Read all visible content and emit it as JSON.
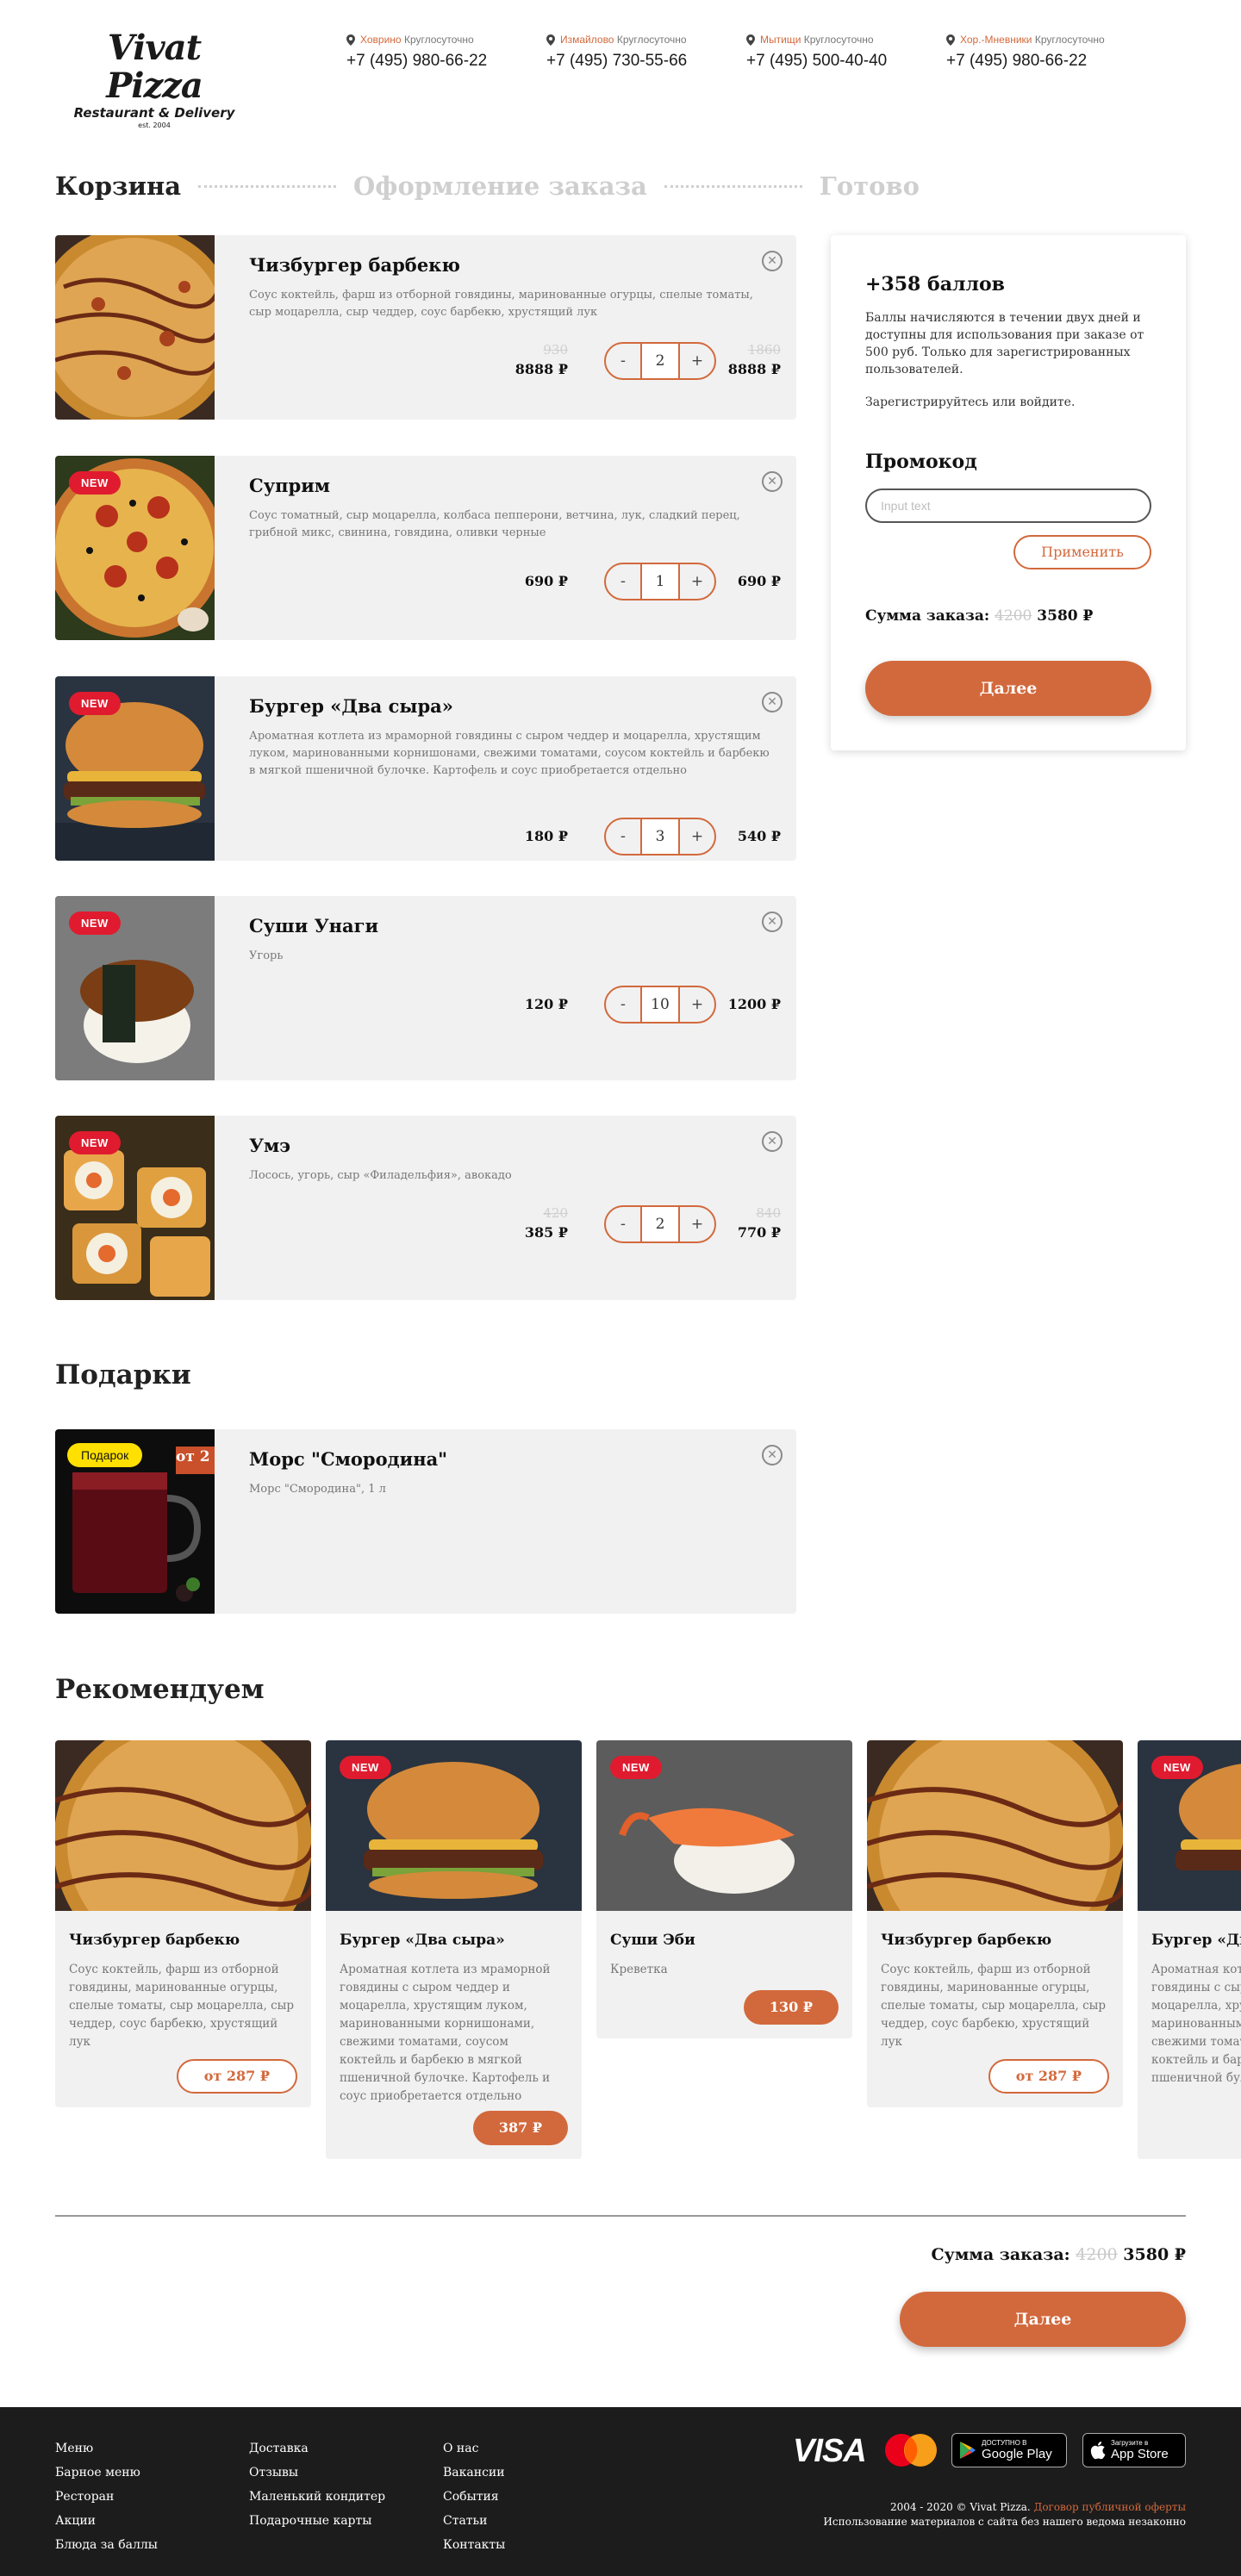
{
  "header": {
    "logo": {
      "line1": "Vivat Pizza",
      "line2": "Restaurant & Delivery",
      "line3": "est. 2004"
    },
    "contacts": [
      {
        "area": "Ховрино",
        "hours": "Круглосуточно",
        "phone": "+7 (495) 980-66-22"
      },
      {
        "area": "Измайлово",
        "hours": "Круглосуточно",
        "phone": "+7 (495) 730-55-66"
      },
      {
        "area": "Мытищи",
        "hours": "Круглосуточно",
        "phone": "+7 (495) 500-40-40"
      },
      {
        "area": "Хор.-Мневники",
        "hours": "Круглосуточно",
        "phone": "+7 (495) 980-66-22"
      }
    ]
  },
  "steps": {
    "cart": "Корзина",
    "checkout": "Оформление заказа",
    "done": "Готово"
  },
  "cart": {
    "items": [
      {
        "title": "Чизбургер барбекю",
        "desc": "Соус коктейль, фарш из отборной говядины, маринованные огурцы, спелые томаты, сыр моцарелла, сыр чеддер, соус барбекю, хрустящий лук",
        "old_price": "930",
        "price": "8888 ₽",
        "qty": "2",
        "old_total": "1860",
        "total": "8888 ₽",
        "badge": ""
      },
      {
        "title": "Суприм",
        "desc": "Соус томатный, сыр моцарелла, колбаса пепперони, ветчина, лук, сладкий перец, грибной микс, свинина, говядина, оливки черные",
        "old_price": "",
        "price": "690 ₽",
        "qty": "1",
        "old_total": "",
        "total": "690 ₽",
        "badge": "NEW"
      },
      {
        "title": "Бургер «Два сыра»",
        "desc": "Ароматная котлета из мраморной говядины с сыром чеддер и моцарелла, хрустящим луком, маринованными корнишонами, свежими томатами, соусом коктейль и барбекю в мягкой пшеничной булочке. Картофель и соус приобретается отдельно",
        "old_price": "",
        "price": "180 ₽",
        "qty": "3",
        "old_total": "",
        "total": "540 ₽",
        "badge": "NEW"
      },
      {
        "title": "Суши Унаги",
        "desc": "Угорь",
        "old_price": "",
        "price": "120 ₽",
        "qty": "10",
        "old_total": "",
        "total": "1200 ₽",
        "badge": "NEW"
      },
      {
        "title": "Умэ",
        "desc": "Лосось, угорь, сыр «Филадельфия», авокадо",
        "old_price": "420",
        "price": "385 ₽",
        "qty": "2",
        "old_total": "840",
        "total": "770 ₽",
        "badge": "NEW"
      }
    ],
    "minus": "-",
    "plus": "+"
  },
  "side": {
    "points": "+358 баллов",
    "note": "Баллы начисляются в течении двух дней и доступны для использования при заказе от 500 руб. Только для зарегистрированных пользователей.",
    "register": "Зарегистрируйтесь или войдите.",
    "promo_title": "Промокод",
    "promo_placeholder": "Input text",
    "apply": "Применить",
    "sum_label": "Сумма заказа:",
    "sum_old": "4200",
    "sum_new": "3580 ₽",
    "next": "Далее"
  },
  "gifts": {
    "title": "Подарки",
    "item": {
      "badge": "Подарок",
      "price_tag": "от 2",
      "title": "Морс \"Смородина\"",
      "desc": "Морс \"Смородина\", 1 л"
    }
  },
  "recommend": {
    "title": "Рекомендуем",
    "cards": [
      {
        "title": "Чизбургер барбекю",
        "desc": "Соус коктейль, фарш из отборной говядины, маринованные огурцы, спелые томаты, сыр моцарелла, сыр чеддер, соус барбекю, хрустящий лук",
        "price": "от 287 ₽",
        "badge": ""
      },
      {
        "title": "Бургер «Два сыра»",
        "desc": "Ароматная котлета из мраморной говядины с сыром чеддер и моцарелла, хрустящим луком, маринованными корнишонами, свежими томатами, соусом коктейль и барбекю в мягкой пшеничной булочке. Картофель и соус приобретается отдельно",
        "price": "387 ₽",
        "badge": "NEW"
      },
      {
        "title": "Суши Эби",
        "desc": "Креветка",
        "price": "130 ₽",
        "badge": "NEW"
      },
      {
        "title": "Чизбургер барбекю",
        "desc": "Соус коктейль, фарш из отборной говядины, маринованные огурцы, спелые томаты, сыр моцарелла, сыр чеддер, соус барбекю, хрустящий лук",
        "price": "от 287 ₽",
        "badge": ""
      },
      {
        "title": "Бургер «Два сыра»",
        "desc": "Ароматная котлета из мраморной говядины с сыром чеддер и моцарелла, хрустящим луком, маринованными корнишонами, свежими томатами, соусом коктейль и барбекю в мягкой пшеничной булочке",
        "price": "",
        "badge": "NEW"
      }
    ]
  },
  "bottom": {
    "sum_label": "Сумма заказа:",
    "sum_old": "4200",
    "sum_new": "3580 ₽",
    "next": "Далее"
  },
  "footer": {
    "col1": [
      "Меню",
      "Барное меню",
      "Ресторан",
      "Акции",
      "Блюда за баллы"
    ],
    "col2": [
      "Доставка",
      "Отзывы",
      "Маленький кондитер",
      "Подарочные карты"
    ],
    "col3": [
      "О нас",
      "Вакансии",
      "События",
      "Статьи",
      "Контакты"
    ],
    "visa": "VISA",
    "google_small": "ДОСТУПНО В",
    "google_big": "Google Play",
    "apple_small": "Загрузите в",
    "apple_big": "App Store",
    "copyright": "2004 - 2020 © Vivat Pizza.",
    "offer_link": "Договор публичной оферты",
    "notice": "Использование материалов с сайта без нашего ведома незаконно"
  },
  "colors": {
    "accent": "#d2693c",
    "badge_new": "#e01b2f",
    "gift_badge": "#ffe000",
    "card_bg": "#f1f1f1",
    "footer_bg": "#1c1c1c"
  }
}
